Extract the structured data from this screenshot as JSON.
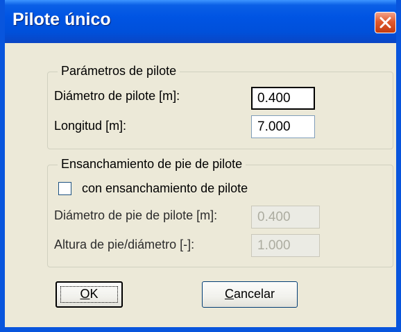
{
  "window": {
    "title": "Pilote único",
    "close_glyph": "✕",
    "title_color": "#0054e3",
    "body_color": "#ece9d8"
  },
  "group_params": {
    "legend": "Parámetros de pilote",
    "diameter_label": "Diámetro de pilote [m]:",
    "diameter_value": "0.400",
    "length_label": "Longitud [m]:",
    "length_value": "7.000"
  },
  "group_widening": {
    "legend": "Ensanchamiento de pie de pilote",
    "checkbox_label": "con ensanchamiento de pilote",
    "checkbox_checked": false,
    "foot_diameter_label": "Diámetro de pie de pilote [m]:",
    "foot_diameter_value": "0.400",
    "foot_height_label": "Altura de pie/diámetro [-]:",
    "foot_height_value": "1.000"
  },
  "buttons": {
    "ok_mnemonic": "O",
    "ok_rest": "K",
    "cancel_mnemonic": "C",
    "cancel_rest": "ancelar"
  }
}
